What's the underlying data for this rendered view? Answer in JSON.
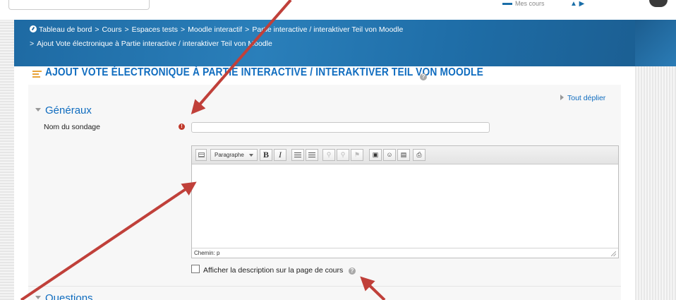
{
  "topbar": {
    "my_courses": "Mes cours"
  },
  "breadcrumb": {
    "items": [
      "Tableau de bord",
      "Cours",
      "Espaces tests",
      "Moodle interactif",
      "Partie interactive / interaktiver Teil von Moodle"
    ],
    "current": "Ajout Vote électronique à Partie interactive / interaktiver Teil von Moodle",
    "separator": ">"
  },
  "page": {
    "title": "AJOUT VOTE ÉLECTRONIQUE À PARTIE INTERACTIVE / INTERAKTIVER TEIL VON MOODLE",
    "expand_all": "Tout déplier"
  },
  "form": {
    "section_general": "Généraux",
    "section_questions": "Questions",
    "name_label": "Nom du sondage",
    "name_value": "",
    "required_icon": "!",
    "editor": {
      "paragraph_label": "Paragraphe",
      "bold": "B",
      "italic": "I",
      "path": "Chemin: p"
    },
    "show_description_label": "Afficher la description sur la page de cours",
    "show_description_checked": false
  },
  "icons": {
    "help": "?"
  },
  "colors": {
    "header_blue": "#1e6aa3",
    "link_blue": "#0f6cbf",
    "annotation_arrow": "#c0403a",
    "required_red": "#c0392b"
  }
}
